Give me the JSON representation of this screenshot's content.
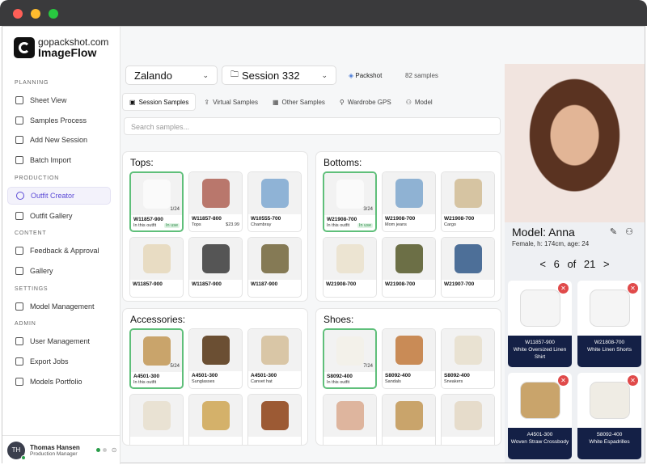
{
  "brand": {
    "top": "gopackshot",
    "domain": ".com",
    "product": "ImageFlow"
  },
  "sidebar": {
    "sections": [
      {
        "label": "PLANNING",
        "items": [
          "Sheet View",
          "Samples Process",
          "Add New Session",
          "Batch Import"
        ]
      },
      {
        "label": "PRODUCTION",
        "items": [
          "Outfit Creator",
          "Outfit Gallery"
        ]
      },
      {
        "label": "CONTENT",
        "items": [
          "Feedback & Approval",
          "Gallery"
        ]
      },
      {
        "label": "SETTINGS",
        "items": [
          "Model Management"
        ]
      },
      {
        "label": "ADMIN",
        "items": [
          "User Management",
          "Export Jobs",
          "Models Portfolio"
        ]
      }
    ],
    "active": "Outfit Creator",
    "user": {
      "initials": "TH",
      "name": "Thomas Hansen",
      "role": "Production Manager"
    }
  },
  "header": {
    "brand_select": "Zalando",
    "session_select": "Session 332",
    "packshot": "Packshot",
    "samples": "82 samples"
  },
  "tabs": [
    "Session Samples",
    "Virtual Samples",
    "Other Samples",
    "Wardrobe GPS",
    "Model"
  ],
  "search": {
    "placeholder": "Search samples..."
  },
  "categories": [
    {
      "title": "Tops:",
      "items": [
        {
          "code": "W11857-900",
          "sub": "In this outfit",
          "badge": "In use",
          "count": "1/24",
          "selected": true,
          "color": "#fafafa"
        },
        {
          "code": "W11857-800",
          "sub": "Tops",
          "price": "$23.99",
          "color": "#b9776c"
        },
        {
          "code": "W10555-700",
          "sub": "Chambray",
          "color": "#8fb3d6"
        },
        {
          "code": "W11857-900",
          "sub": "",
          "color": "#e8dcc3"
        },
        {
          "code": "W11857-900",
          "sub": "",
          "color": "#555555"
        },
        {
          "code": "W1187-900",
          "sub": "",
          "color": "#857a55"
        }
      ]
    },
    {
      "title": "Bottoms:",
      "items": [
        {
          "code": "W21908-700",
          "sub": "In this outfit",
          "badge": "In use",
          "count": "3/24",
          "selected": true,
          "color": "#fafafa"
        },
        {
          "code": "W21908-700",
          "sub": "Mom jeans",
          "color": "#8fb2d3"
        },
        {
          "code": "W21908-700",
          "sub": "Cargo",
          "color": "#d6c4a2"
        },
        {
          "code": "W21908-700",
          "sub": "",
          "color": "#ece4d2"
        },
        {
          "code": "W21908-700",
          "sub": "",
          "color": "#6c6f46"
        },
        {
          "code": "W21907-700",
          "sub": "",
          "color": "#4d6f98"
        }
      ]
    },
    {
      "title": "Accessories:",
      "items": [
        {
          "code": "A4501-300",
          "sub": "In this outfit",
          "count": "5/24",
          "selected": true,
          "color": "#c9a46b"
        },
        {
          "code": "A4501-300",
          "sub": "Sunglasses",
          "color": "#6b4f33"
        },
        {
          "code": "A4501-300",
          "sub": "Canvet hat",
          "color": "#d9c6a6"
        },
        {
          "code": "",
          "sub": "",
          "color": "#e9e2d3"
        },
        {
          "code": "",
          "sub": "",
          "color": "#d4b16a"
        },
        {
          "code": "",
          "sub": "",
          "color": "#9c5a34"
        }
      ]
    },
    {
      "title": "Shoes:",
      "items": [
        {
          "code": "S8092-400",
          "sub": "In this outfit",
          "count": "7/24",
          "selected": true,
          "color": "#f3f1ea"
        },
        {
          "code": "S8092-400",
          "sub": "Sandals",
          "color": "#c98b56"
        },
        {
          "code": "S8092-400",
          "sub": "Sneakers",
          "color": "#e9e2d2"
        },
        {
          "code": "",
          "sub": "",
          "color": "#deb59e"
        },
        {
          "code": "",
          "sub": "",
          "color": "#c9a46b"
        },
        {
          "code": "",
          "sub": "",
          "color": "#e6dccb"
        }
      ]
    }
  ],
  "model": {
    "name": "Model: Anna",
    "info": "Female, h: 174cm, age: 24",
    "pager": "6 of 21",
    "prev": "<",
    "next": ">",
    "outfit": [
      {
        "code": "W11857-900",
        "name": "White Oversized Linen Shirt",
        "color": "#f5f5f5"
      },
      {
        "code": "W21808-700",
        "name": "White Linen Shorts",
        "color": "#f5f5f5"
      },
      {
        "code": "A4501-300",
        "name": "Woven Straw Crossbody",
        "color": "#c9a46b"
      },
      {
        "code": "S8092-400",
        "name": "White Espadrilles",
        "color": "#efece4"
      }
    ]
  },
  "colors": {
    "accent": "#5b4ad6",
    "selected": "#5fbf7a",
    "label_bg": "#142046",
    "remove": "#e04a4a"
  }
}
